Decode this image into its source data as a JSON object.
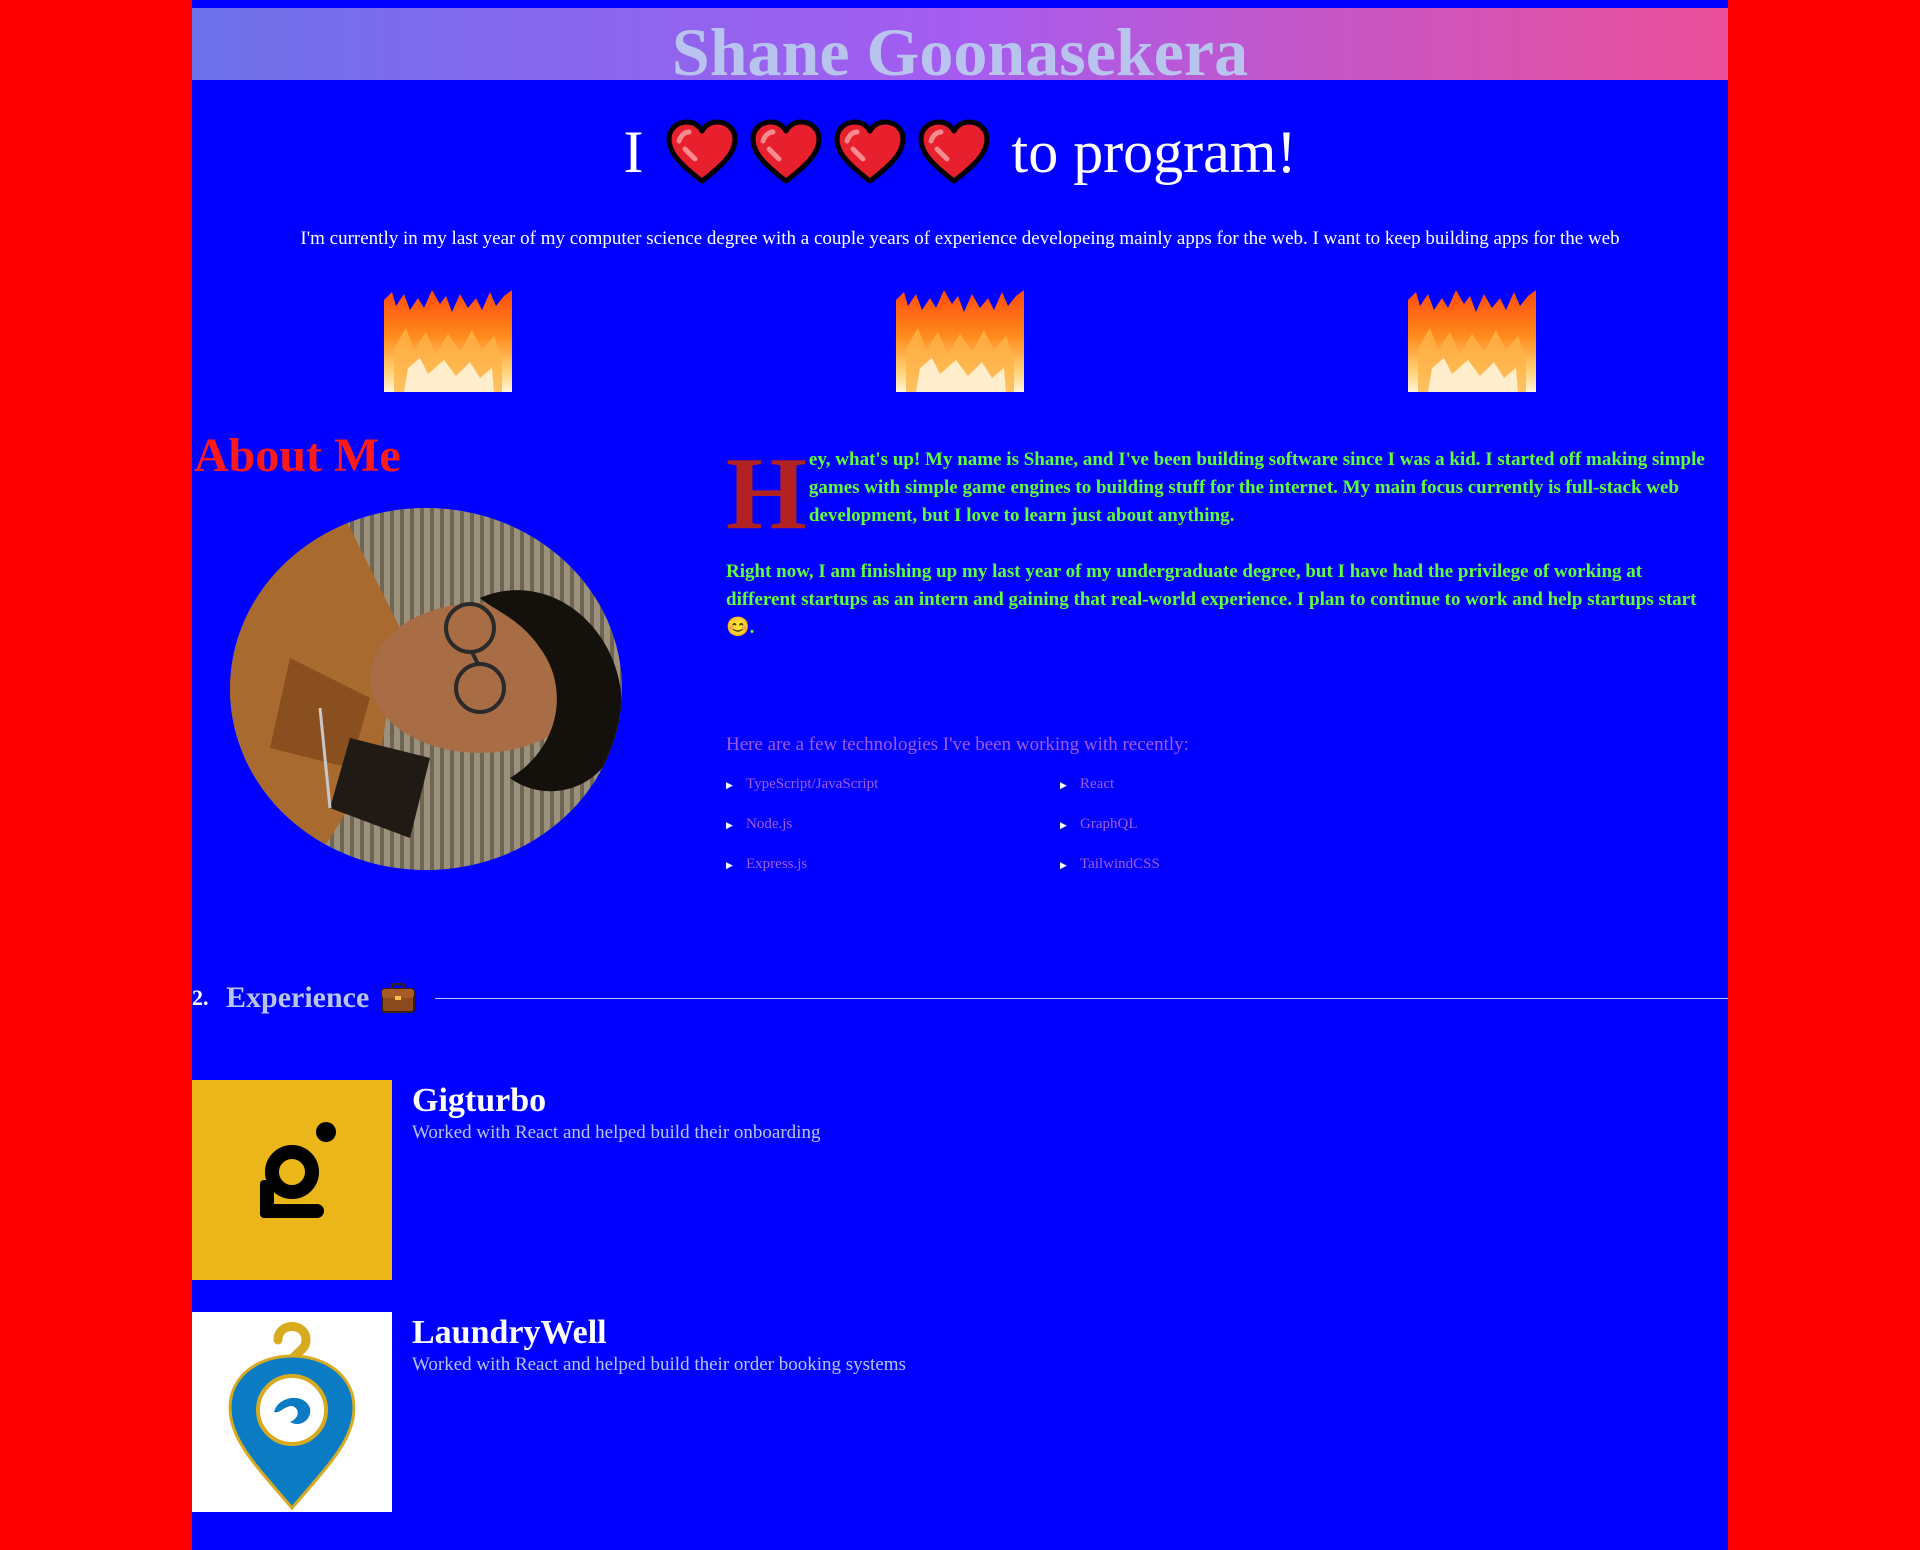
{
  "header": {
    "title": "Shane Goonasekera"
  },
  "hero": {
    "word_before": "I",
    "word_after": "to program!",
    "heart_count": 4,
    "heart_icon": "heart-icon",
    "intro": "I'm currently in my last year of my computer science degree with a couple years of experience developeing mainly apps for the web. I want to keep building apps for the web",
    "fire_icon": "fire-icon"
  },
  "about": {
    "heading": "About Me",
    "dropcap": "H",
    "paragraph1": "ey, what's up! My name is Shane, and I've been building software since I was a kid. I started off making simple games with simple game engines to building stuff for the internet. My main focus currently is full-stack web development, but I love to learn just about anything.",
    "paragraph2": "Right now, I am finishing up my last year of my undergraduate degree, but I have had the privilege of working at different startups as an intern and gaining that real-world experience. I plan to continue to work and help startups start",
    "paragraph2_emoji": "😊",
    "paragraph2_end": ".",
    "tech_intro": "Here are a few technologies I've been working with recently:",
    "technologies": [
      "TypeScript/JavaScript",
      "React",
      "Node.js",
      "GraphQL",
      "Express.js",
      "TailwindCSS"
    ]
  },
  "experience": {
    "number": "2.",
    "title": "Experience",
    "icon": "briefcase-icon",
    "jobs": [
      {
        "name": "Gigturbo",
        "description": "Worked with React and helped build their onboarding",
        "logo_color": "#ebb619"
      },
      {
        "name": "LaundryWell",
        "description": "Worked with React and helped build their order booking systems",
        "logo_color": "#ffffff"
      }
    ]
  },
  "colors": {
    "outer_bg": "#ff0000",
    "page_bg": "#0000ff",
    "about_heading": "#ff1a1a",
    "bio_text": "#5dff3a",
    "tech_text": "#a05be0",
    "muted_text": "#b9c4ee"
  }
}
